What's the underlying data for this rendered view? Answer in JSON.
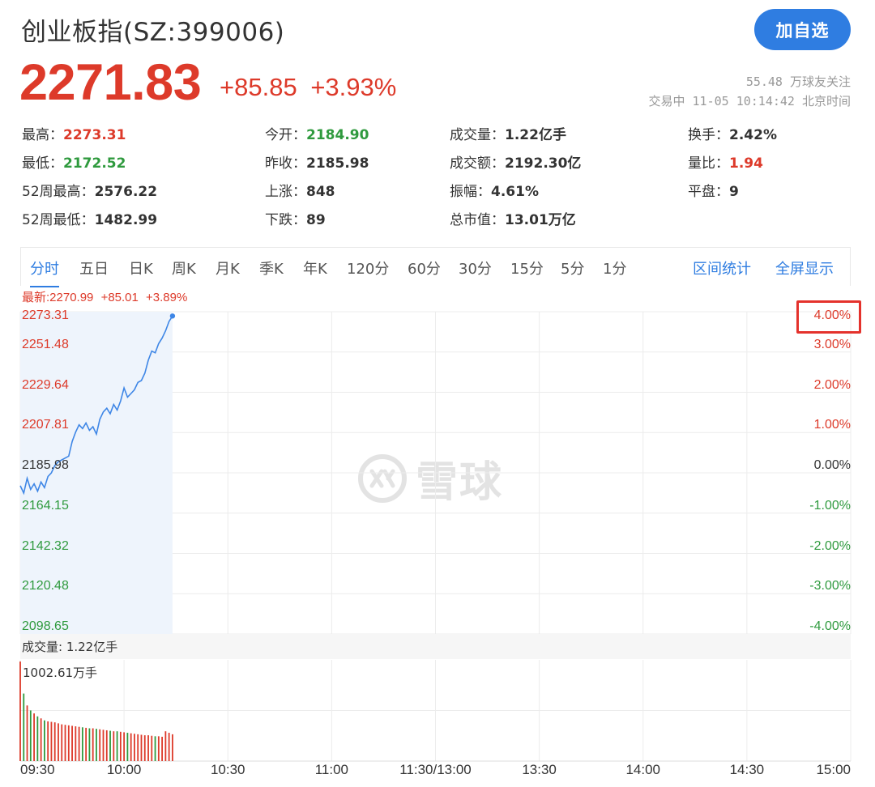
{
  "header": {
    "title": "创业板指(SZ:399006)",
    "add_button": "加自选",
    "price": "2271.83",
    "change": "+85.85",
    "change_pct": "+3.93%",
    "followers": "55.48 万球友关注",
    "status": "交易中 11-05 10:14:42 北京时间"
  },
  "stats": [
    [
      {
        "label": "最高：",
        "value": "2273.31",
        "color": "red"
      },
      {
        "label": "今开：",
        "value": "2184.90",
        "color": "green"
      },
      {
        "label": "成交量：",
        "value": "1.22亿手",
        "color": "black"
      },
      {
        "label": "换手：",
        "value": "2.42%",
        "color": "black"
      }
    ],
    [
      {
        "label": "最低：",
        "value": "2172.52",
        "color": "green"
      },
      {
        "label": "昨收：",
        "value": "2185.98",
        "color": "black"
      },
      {
        "label": "成交额：",
        "value": "2192.30亿",
        "color": "black"
      },
      {
        "label": "量比：",
        "value": "1.94",
        "color": "red"
      }
    ],
    [
      {
        "label": "52周最高：",
        "value": "2576.22",
        "color": "black"
      },
      {
        "label": "上涨：",
        "value": "848",
        "color": "black"
      },
      {
        "label": "振幅：",
        "value": "4.61%",
        "color": "black"
      },
      {
        "label": "平盘：",
        "value": "9",
        "color": "black"
      }
    ],
    [
      {
        "label": "52周最低：",
        "value": "1482.99",
        "color": "black"
      },
      {
        "label": "下跌：",
        "value": "89",
        "color": "black"
      },
      {
        "label": "总市值：",
        "value": "13.01万亿",
        "color": "black"
      }
    ]
  ],
  "tabs": [
    "分时",
    "五日",
    "日K",
    "周K",
    "月K",
    "季K",
    "年K",
    "120分",
    "60分",
    "30分",
    "15分",
    "5分",
    "1分"
  ],
  "tab_actions": [
    "区间统计",
    "全屏显示"
  ],
  "latest": {
    "label": "最新:2270.99",
    "change": "+85.01",
    "pct": "+3.89%"
  },
  "volume": {
    "label": "成交量: 1.22亿手",
    "max_label": "1002.61万手"
  },
  "watermark": "雪球",
  "colors": {
    "up": "#dd3a2a",
    "down": "#2f9a3e",
    "accent": "#2f7de1",
    "line": "#3e86e6"
  },
  "chart_data": {
    "type": "line",
    "y_left_ticks": [
      "2273.31",
      "2251.48",
      "2229.64",
      "2207.81",
      "2185.98",
      "2164.15",
      "2142.32",
      "2120.48",
      "2098.65"
    ],
    "y_right_ticks": [
      "4.00%",
      "3.00%",
      "2.00%",
      "1.00%",
      "0.00%",
      "-1.00%",
      "-2.00%",
      "-3.00%",
      "-4.00%"
    ],
    "x_ticks": [
      "09:30",
      "10:00",
      "10:30",
      "11:00",
      "11:30/13:00",
      "13:30",
      "14:00",
      "14:30",
      "15:00"
    ],
    "ylim": [
      2098.65,
      2273.31
    ],
    "prev_close": 2185.98,
    "total_minutes": 240,
    "series": [
      {
        "x": [
          0,
          1,
          2,
          3,
          4,
          5,
          6,
          7,
          8,
          9,
          10,
          11,
          12,
          13,
          14,
          15,
          16,
          17,
          18,
          19,
          20,
          21,
          22,
          23,
          24,
          25,
          26,
          27,
          28,
          29,
          30,
          31,
          32,
          33,
          34,
          35,
          36,
          37,
          38,
          39,
          40,
          41,
          42,
          43,
          44
        ],
        "values": [
          2179,
          2175,
          2183,
          2177,
          2180,
          2176,
          2181,
          2178,
          2184,
          2186,
          2190,
          2192,
          2193,
          2194,
          2195,
          2203,
          2208,
          2212,
          2210,
          2213,
          2209,
          2211,
          2207,
          2215,
          2219,
          2221,
          2218,
          2223,
          2220,
          2225,
          2232,
          2227,
          2229,
          2231,
          2235,
          2236,
          2240,
          2247,
          2252,
          2251,
          2256,
          2259,
          2263,
          2268,
          2271
        ]
      }
    ],
    "volume_max": 1002.61,
    "volume": [
      1002.61,
      680,
      560,
      510,
      480,
      450,
      430,
      410,
      400,
      395,
      390,
      380,
      370,
      365,
      360,
      355,
      350,
      345,
      340,
      335,
      330,
      330,
      325,
      320,
      315,
      310,
      305,
      300,
      300,
      295,
      290,
      285,
      280,
      275,
      270,
      265,
      260,
      260,
      255,
      250,
      250,
      245,
      300,
      285,
      270
    ]
  }
}
